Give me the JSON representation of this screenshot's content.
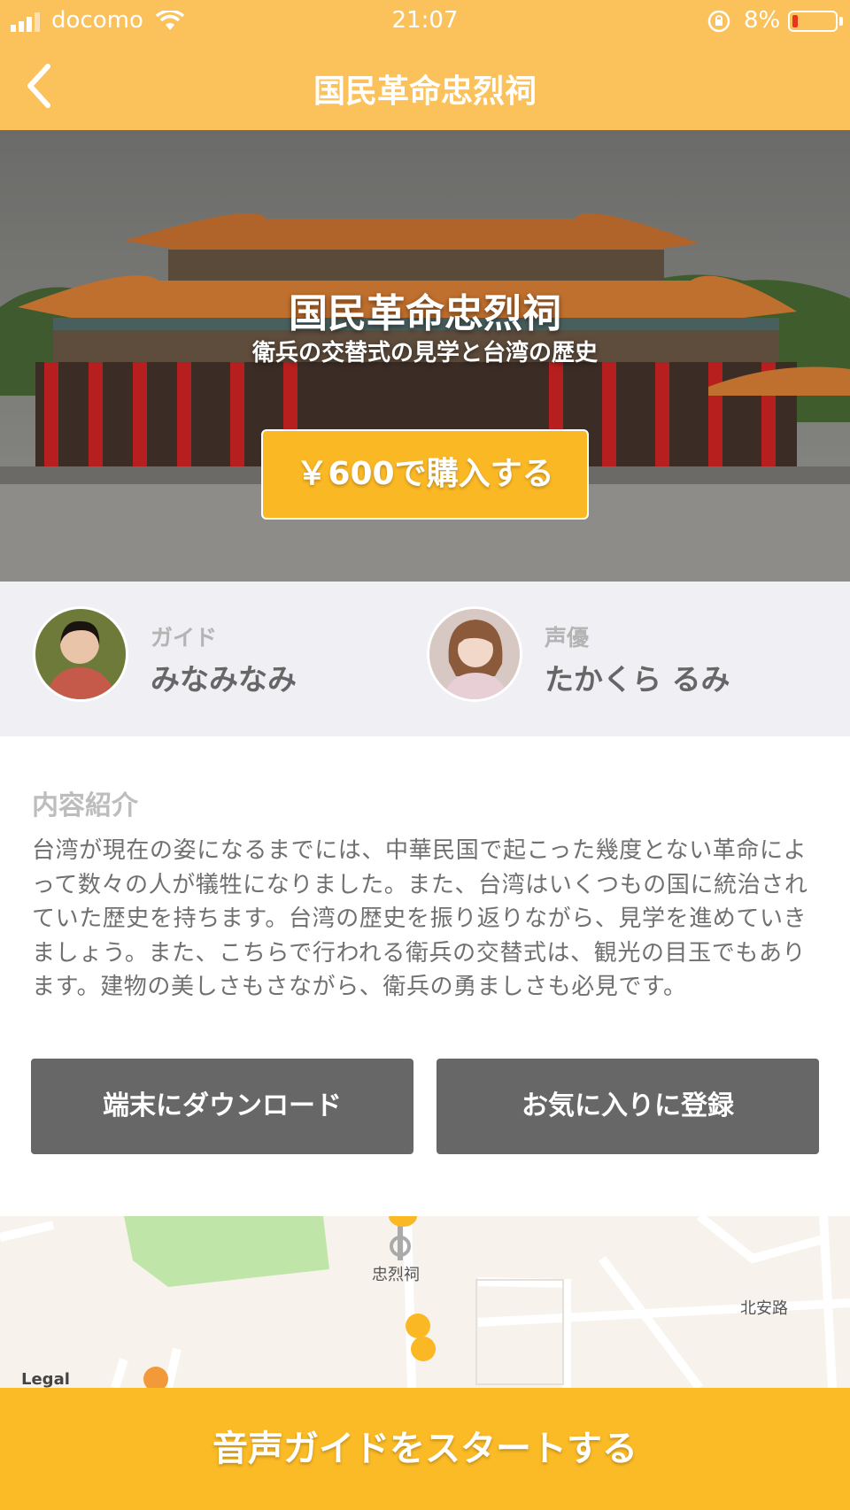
{
  "status_bar": {
    "carrier": "docomo",
    "time": "21:07",
    "battery": "8%"
  },
  "nav": {
    "title": "国民革命忠烈祠"
  },
  "hero": {
    "title": "国民革命忠烈祠",
    "subtitle": "衛兵の交替式の見学と台湾の歴史",
    "buy_label": "￥600で購入する"
  },
  "people": [
    {
      "role": "ガイド",
      "name": "みなみなみ"
    },
    {
      "role": "声優",
      "name": "たかくら るみ"
    }
  ],
  "description": {
    "title": "内容紹介",
    "body": "台湾が現在の姿になるまでには、中華民国で起こった幾度とない革命によって数々の人が犠牲になりました。また、台湾はいくつもの国に統治されていた歴史を持ちます。台湾の歴史を振り返りながら、見学を進めていきましょう。また、こちらで行われる衛兵の交替式は、観光の目玉でもあります。建物の美しさもさながら、衛兵の勇ましさも必見です。"
  },
  "actions": {
    "download": "端末にダウンロード",
    "favorite": "お気に入りに登録"
  },
  "map": {
    "place_label": "忠烈祠",
    "road_label": "北安路",
    "legal": "Legal"
  },
  "bottom": {
    "start_label": "音声ガイドをスタートする"
  },
  "colors": {
    "accent": "#fbbb26",
    "nav": "#fbc15a",
    "button_gray": "#676767",
    "people_bg": "#efeff4"
  }
}
